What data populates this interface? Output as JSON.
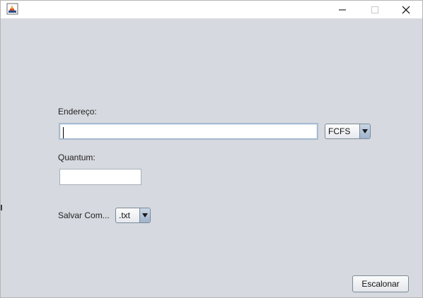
{
  "window": {
    "title": "",
    "controls": {
      "minimize": "minimize-icon",
      "maximize": "maximize-icon",
      "close": "close-icon"
    }
  },
  "form": {
    "endereco_label": "Endereço:",
    "endereco_value": "",
    "algorithm_selected": "FCFS",
    "quantum_label": "Quantum:",
    "quantum_value": "",
    "salvar_label": "Salvar Com...",
    "format_selected": ".txt",
    "submit_label": "Escalonar"
  },
  "colors": {
    "background": "#d6d9df",
    "titlebar": "#ffffff",
    "focus_border": "#a8bbd1"
  }
}
